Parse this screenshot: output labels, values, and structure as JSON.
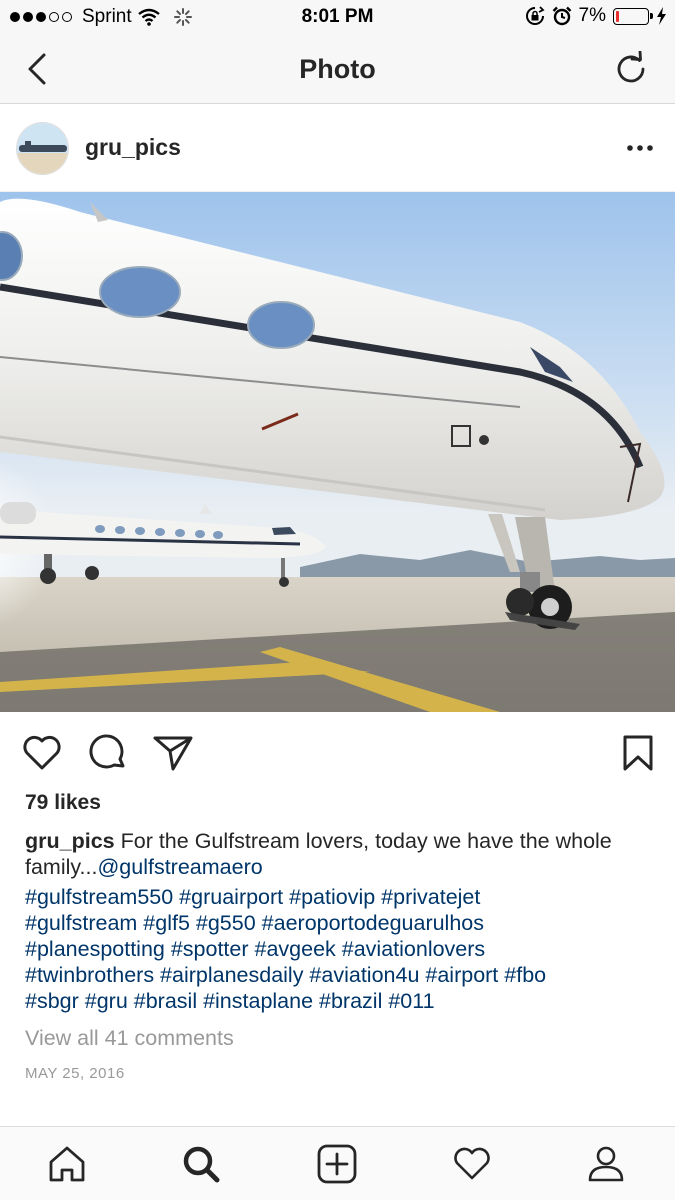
{
  "status_bar": {
    "carrier": "Sprint",
    "time": "8:01 PM",
    "battery_percent": "7%",
    "battery_level": 0.07,
    "signal_bars_filled": 3,
    "signal_bars_total": 5,
    "icons": [
      "wifi-icon",
      "loading-spinner-icon",
      "orientation-lock-icon",
      "alarm-icon",
      "charging-bolt-icon"
    ],
    "battery_color": "#e8322f"
  },
  "nav": {
    "title": "Photo",
    "back_icon": "chevron-left-icon",
    "refresh_icon": "refresh-icon"
  },
  "post": {
    "username": "gru_pics",
    "more_icon": "more-horizontal-icon",
    "likes": "79 likes",
    "caption_username": "gru_pics",
    "caption_text": "For the Gulfstream lovers, today we have the whole family...",
    "caption_mention": "@gulfstreamaero",
    "hashtag_lines": [
      "#gulfstream550 #gruairport #patiovip #privatejet",
      "#gulfstream #glf5 #g550 #aeroportodeguarulhos",
      "#planespotting #spotter #avgeek #aviationlovers",
      "#twinbrothers #airplanesdaily #aviation4u #airport #fbo",
      "#sbgr #gru #brasil #instaplane #brazil #011"
    ],
    "view_comments": "View all 41 comments",
    "date": "MAY 25, 2016",
    "action_icons": [
      "heart-icon",
      "comment-icon",
      "share-icon",
      "bookmark-icon"
    ]
  },
  "tab_bar": {
    "icons": [
      "home-icon",
      "search-icon",
      "add-post-icon",
      "activity-heart-icon",
      "profile-icon"
    ]
  },
  "colors": {
    "link": "#003569",
    "text": "#262626",
    "muted": "#999999",
    "bar_bg": "#f7f7f7"
  }
}
